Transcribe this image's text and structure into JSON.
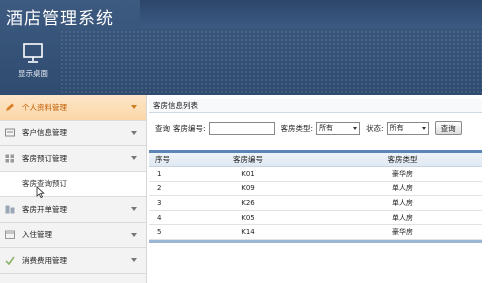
{
  "app": {
    "title": "酒店管理系统"
  },
  "toolbar": {
    "desktop_label": "显示桌面"
  },
  "sidebar": {
    "items": [
      {
        "label": "个人资料管理",
        "active": true,
        "icon": "pencil-icon"
      },
      {
        "label": "客户信息管理",
        "active": false,
        "icon": "card-icon"
      },
      {
        "label": "客房预订管理",
        "active": false,
        "icon": "grid-icon"
      },
      {
        "label": "客房查询预订",
        "sub": true
      },
      {
        "label": "客房开单管理",
        "active": false,
        "icon": "blocks-icon"
      },
      {
        "label": "入住管理",
        "active": false,
        "icon": "calendar-icon"
      },
      {
        "label": "消费费用管理",
        "active": false,
        "icon": "check-icon"
      }
    ]
  },
  "main": {
    "panel_title": "客房信息列表",
    "search": {
      "query_label": "查询",
      "room_no_label": "客房编号:",
      "room_no_value": "",
      "room_type_label": "客房类型:",
      "room_type_value": "所有",
      "status_label": "状态:",
      "status_value": "所有",
      "button_label": "查询"
    },
    "table": {
      "headers": [
        "序号",
        "客房编号",
        "客房类型"
      ],
      "rows": [
        [
          "1",
          "K01",
          "豪华房"
        ],
        [
          "2",
          "K09",
          "单人房"
        ],
        [
          "3",
          "K26",
          "单人房"
        ],
        [
          "4",
          "K05",
          "单人房"
        ],
        [
          "5",
          "K14",
          "豪华房"
        ]
      ]
    }
  },
  "colors": {
    "header_bg": "#3d5a80",
    "active_item_bg": "#fbd7a8",
    "active_item_text": "#c05a00",
    "table_accent": "#5c86b8"
  }
}
